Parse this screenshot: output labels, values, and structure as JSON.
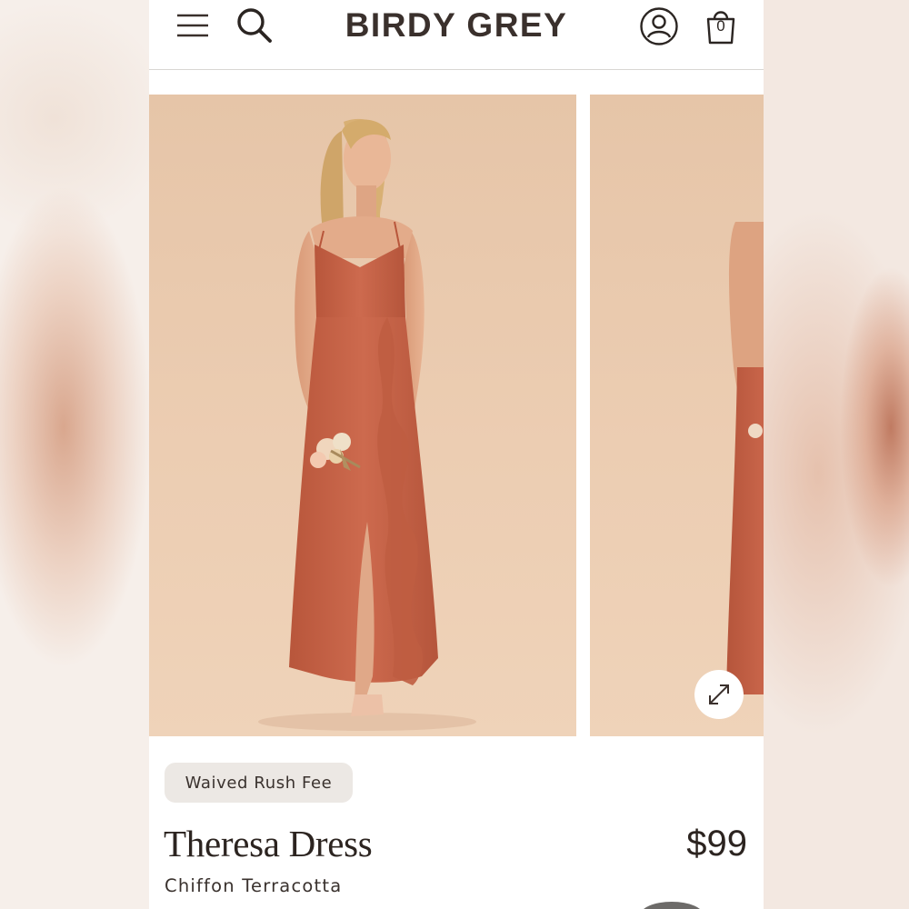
{
  "brand": {
    "name": "BIRDY GREY"
  },
  "header": {
    "menu_icon": "hamburger-menu-icon",
    "search_icon": "search-icon",
    "account_icon": "account-icon",
    "cart_icon": "shopping-bag-icon",
    "cart_count": "0"
  },
  "gallery": {
    "expand_icon": "expand-arrows-icon",
    "background_color": "#e9c9ad",
    "dress_color": "#c9654a"
  },
  "product": {
    "badge": "Waived Rush Fee",
    "name": "Theresa Dress",
    "price": "$99",
    "variant": "Chiffon Terracotta"
  },
  "colors": {
    "text": "#2c2420",
    "badge_bg": "#ece8e4",
    "divider": "#d9d6d3"
  }
}
